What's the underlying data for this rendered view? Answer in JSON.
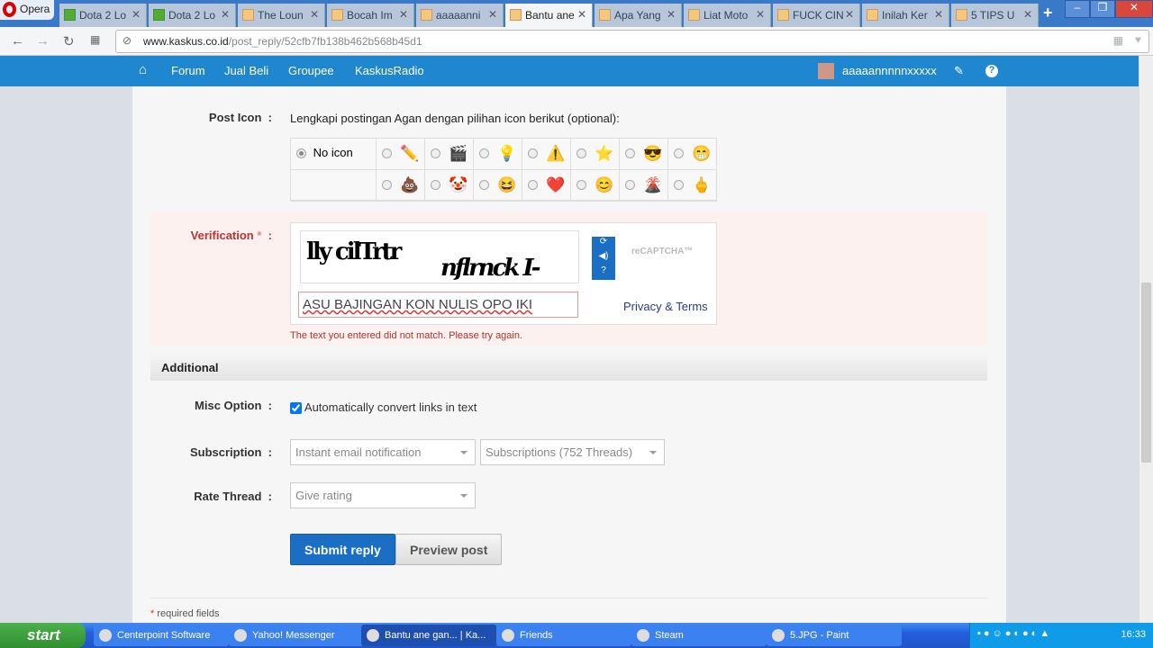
{
  "browser": {
    "menu_label": "Opera",
    "tabs": [
      {
        "title": "Dota 2 Lo",
        "icon": "dota"
      },
      {
        "title": "Dota 2 Lo",
        "icon": "dota"
      },
      {
        "title": "The Loun",
        "icon": "kaskus"
      },
      {
        "title": "Bocah Im",
        "icon": "kaskus"
      },
      {
        "title": "aaaaanni",
        "icon": "kaskus"
      },
      {
        "title": "Bantu ane",
        "icon": "kaskus",
        "active": true
      },
      {
        "title": "Apa Yang",
        "icon": "kaskus"
      },
      {
        "title": "Liat Moto",
        "icon": "kaskus"
      },
      {
        "title": "FUCK CIN",
        "icon": "kaskus"
      },
      {
        "title": "Inilah Ker",
        "icon": "kaskus"
      },
      {
        "title": "5 TIPS U",
        "icon": "kaskus"
      }
    ],
    "url_domain": "www.kaskus.co.id",
    "url_path": "/post_reply/52cfb7fb138b462b568b45d1"
  },
  "site_nav": {
    "items": [
      "Forum",
      "Jual Beli",
      "Groupee",
      "KaskusRadio"
    ],
    "username": "aaaaannnnnxxxxx",
    "brand_color": "#1f86d0"
  },
  "form": {
    "post_icon_label": "Post Icon",
    "post_icon_hint": "Lengkapi postingan Agan dengan pilihan icon berikut (optional):",
    "no_icon_label": "No icon",
    "icons_row1": [
      "✏️",
      "🎬",
      "💡",
      "⚠️",
      "⭐",
      "😎",
      "😁"
    ],
    "icons_row2": [
      "💩",
      "🤡",
      "😆",
      "❤️",
      "😊",
      "🌋",
      "🖕"
    ],
    "verification_label": "Verification",
    "required_mark": "*",
    "captcha_text_1": "lly cilTrtr",
    "captcha_text_2": "nflrnck I-",
    "captcha_logo": "reCAPTCHA™",
    "captcha_input": "ASU BAJINGAN KON NULIS OPO IKI",
    "privacy_terms": "Privacy & Terms",
    "error": "The text you entered did not match. Please try again.",
    "additional_heading": "Additional",
    "misc_label": "Misc Option",
    "misc_checkbox": "Automatically convert links in text",
    "misc_checked": true,
    "subscription_label": "Subscription",
    "subscription_value": "Instant email notification",
    "subscription_folder": "Subscriptions (752 Threads)",
    "rate_label": "Rate Thread",
    "rate_value": "Give rating",
    "submit": "Submit reply",
    "preview": "Preview post",
    "required_note": "required fields"
  },
  "taskbar": {
    "start": "start",
    "items": [
      {
        "label": "Centerpoint Software"
      },
      {
        "label": "Yahoo! Messenger"
      },
      {
        "label": "Bantu ane gan... | Ka...",
        "active": true
      },
      {
        "label": "Friends"
      },
      {
        "label": "Steam"
      },
      {
        "label": "5.JPG - Paint"
      }
    ],
    "clock": "16:33"
  }
}
